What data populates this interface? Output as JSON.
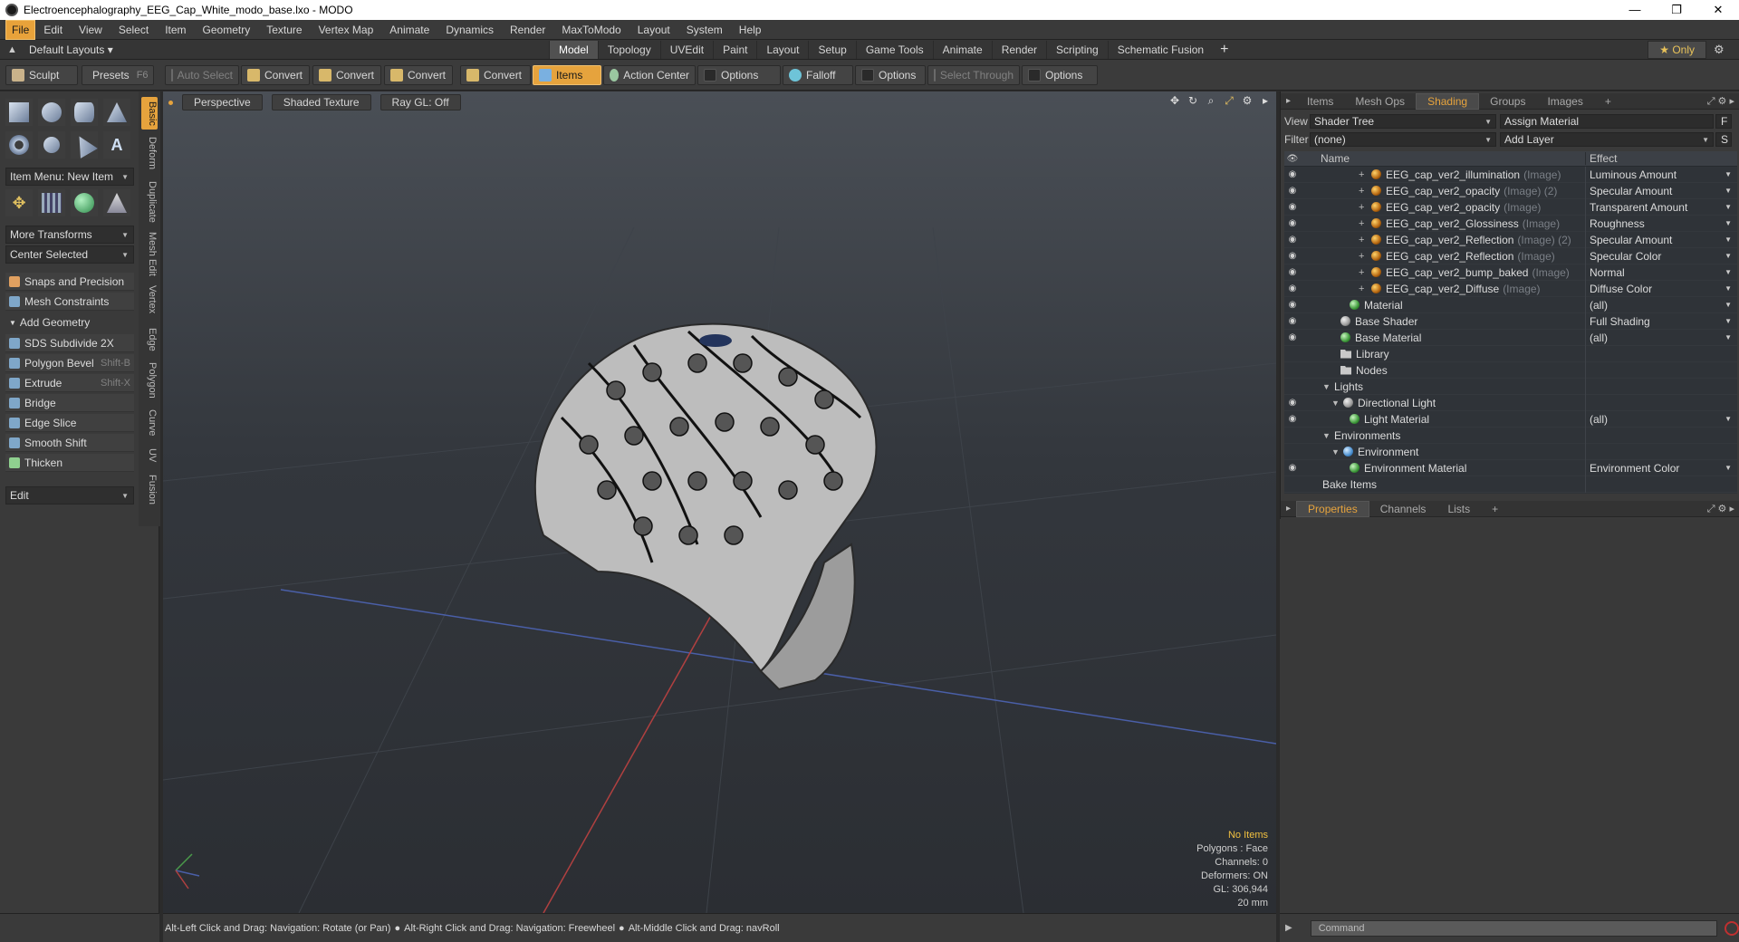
{
  "window": {
    "title": "Electroencephalography_EEG_Cap_White_modo_base.lxo - MODO",
    "minimize": "—",
    "restore": "❐",
    "close": "✕"
  },
  "menu": [
    "File",
    "Edit",
    "View",
    "Select",
    "Item",
    "Geometry",
    "Texture",
    "Vertex Map",
    "Animate",
    "Dynamics",
    "Render",
    "MaxToModo",
    "Layout",
    "System",
    "Help"
  ],
  "layouts": {
    "label": "Default Layouts ▾",
    "tabs": [
      "Model",
      "Topology",
      "UVEdit",
      "Paint",
      "Layout",
      "Setup",
      "Game Tools",
      "Animate",
      "Render",
      "Scripting",
      "Schematic Fusion"
    ],
    "active": "Model",
    "plus": "+",
    "only": "★ Only"
  },
  "toolbar": {
    "sculpt": "Sculpt",
    "presets": "Presets",
    "presets_key": "F6",
    "auto_select": "Auto Select",
    "convert1": "Convert",
    "convert2": "Convert",
    "convert3": "Convert",
    "convert4": "Convert",
    "items": "Items",
    "action_center": "Action Center",
    "options1": "Options",
    "falloff": "Falloff",
    "options2": "Options",
    "select_through": "Select Through",
    "options3": "Options"
  },
  "left": {
    "vtabs": [
      "Basic",
      "Deform",
      "Duplicate",
      "Mesh Edit",
      "Vertex",
      "Edge",
      "Polygon",
      "Curve",
      "UV",
      "Fusion"
    ],
    "item_menu": "Item Menu: New Item",
    "more_transforms": "More Transforms",
    "center_selected": "Center Selected",
    "snaps": "Snaps and Precision",
    "mesh_constraints": "Mesh Constraints",
    "add_geometry": "Add Geometry",
    "tools": [
      {
        "label": "SDS Subdivide 2X",
        "key": ""
      },
      {
        "label": "Polygon Bevel",
        "key": "Shift-B"
      },
      {
        "label": "Extrude",
        "key": "Shift-X"
      },
      {
        "label": "Bridge",
        "key": ""
      },
      {
        "label": "Edge Slice",
        "key": ""
      },
      {
        "label": "Smooth Shift",
        "key": ""
      },
      {
        "label": "Thicken",
        "key": ""
      }
    ],
    "edit": "Edit"
  },
  "viewport": {
    "perspective": "Perspective",
    "shaded_texture": "Shaded Texture",
    "ray_gl": "Ray GL: Off",
    "info": {
      "no_items": "No Items",
      "polygons": "Polygons : Face",
      "channels": "Channels: 0",
      "deformers": "Deformers: ON",
      "gl": "GL: 306,944",
      "scale": "20 mm"
    }
  },
  "right": {
    "tabs": [
      "Items",
      "Mesh Ops",
      "Shading",
      "Groups",
      "Images"
    ],
    "active_tab": "Shading",
    "plus": "+",
    "view_label": "View",
    "view_value": "Shader Tree",
    "assign_material": "Assign Material",
    "assign_f": "F",
    "filter_label": "Filter",
    "filter_value": "(none)",
    "add_layer": "Add Layer",
    "add_layer_s": "S",
    "col_name": "Name",
    "col_effect": "Effect",
    "rows": [
      {
        "name": "EEG_cap_ver2_illumination",
        "tag": "(Image)",
        "effect": "Luminous Amount",
        "kind": "img"
      },
      {
        "name": "EEG_cap_ver2_opacity",
        "tag": "(Image) (2)",
        "effect": "Specular Amount",
        "kind": "img"
      },
      {
        "name": "EEG_cap_ver2_opacity",
        "tag": "(Image)",
        "effect": "Transparent Amount",
        "kind": "img"
      },
      {
        "name": "EEG_cap_ver2_Glossiness",
        "tag": "(Image)",
        "effect": "Roughness",
        "kind": "img"
      },
      {
        "name": "EEG_cap_ver2_Reflection",
        "tag": "(Image) (2)",
        "effect": "Specular Amount",
        "kind": "img"
      },
      {
        "name": "EEG_cap_ver2_Reflection",
        "tag": "(Image)",
        "effect": "Specular Color",
        "kind": "img"
      },
      {
        "name": "EEG_cap_ver2_bump_baked",
        "tag": "(Image)",
        "effect": "Normal",
        "kind": "img"
      },
      {
        "name": "EEG_cap_ver2_Diffuse",
        "tag": "(Image)",
        "effect": "Diffuse Color",
        "kind": "img"
      },
      {
        "name": "Material",
        "tag": "",
        "effect": "(all)",
        "kind": "mat"
      },
      {
        "name": "Base Shader",
        "tag": "",
        "effect": "Full Shading",
        "kind": "shd"
      },
      {
        "name": "Base Material",
        "tag": "",
        "effect": "(all)",
        "kind": "mat"
      },
      {
        "name": "Library",
        "tag": "",
        "effect": "",
        "kind": "folder"
      },
      {
        "name": "Nodes",
        "tag": "",
        "effect": "",
        "kind": "folder"
      },
      {
        "name": "Lights",
        "tag": "",
        "effect": "",
        "kind": "group"
      },
      {
        "name": "Directional Light",
        "tag": "",
        "effect": "",
        "kind": "light"
      },
      {
        "name": "Light Material",
        "tag": "",
        "effect": "(all)",
        "kind": "mat"
      },
      {
        "name": "Environments",
        "tag": "",
        "effect": "",
        "kind": "group"
      },
      {
        "name": "Environment",
        "tag": "",
        "effect": "",
        "kind": "env"
      },
      {
        "name": "Environment Material",
        "tag": "",
        "effect": "Environment Color",
        "kind": "mat"
      },
      {
        "name": "Bake Items",
        "tag": "",
        "effect": "",
        "kind": "plain"
      }
    ],
    "props_tabs": [
      "Properties",
      "Channels",
      "Lists"
    ],
    "props_active": "Properties"
  },
  "status": {
    "hint1": "Alt-Left Click and Drag: Navigation: Rotate (or Pan)",
    "hint2": "Alt-Right Click and Drag: Navigation: Freewheel",
    "hint3": "Alt-Middle Click and Drag: navRoll",
    "command_placeholder": "Command"
  }
}
